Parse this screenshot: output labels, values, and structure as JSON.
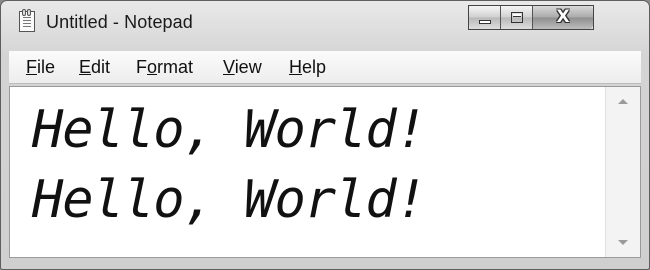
{
  "window": {
    "title": "Untitled - Notepad",
    "app_icon": "notepad-icon"
  },
  "caption_buttons": {
    "minimize_icon": "minimize-icon",
    "maximize_icon": "maximize-icon",
    "close_icon": "close-icon",
    "close_glyph": "X"
  },
  "menu": {
    "items": [
      {
        "accel": "F",
        "rest": "ile"
      },
      {
        "accel": "E",
        "rest": "dit"
      },
      {
        "pre": "F",
        "accel": "o",
        "rest": "rmat"
      },
      {
        "accel": "V",
        "rest": "iew"
      },
      {
        "accel": "H",
        "rest": "elp"
      }
    ]
  },
  "editor": {
    "lines": [
      "Hello, World!",
      "Hello, World!"
    ]
  },
  "scrollbar": {
    "up_icon": "scroll-up-arrow-icon",
    "down_icon": "scroll-down-arrow-icon"
  }
}
